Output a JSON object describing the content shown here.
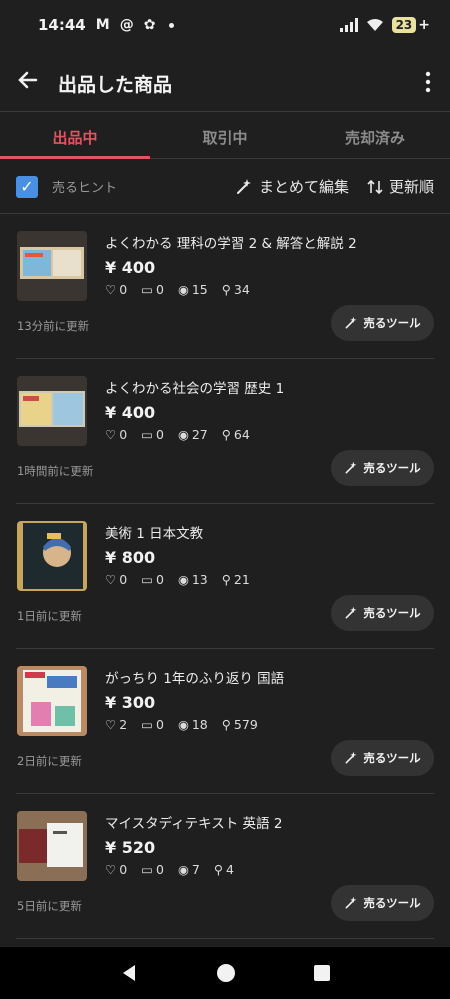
{
  "status_bar": {
    "time": "14:44",
    "battery": "23",
    "notification_icons": [
      "gmail-icon",
      "threads-icon",
      "app-icon"
    ]
  },
  "appbar": {
    "title": "出品した商品"
  },
  "tabs": [
    {
      "label": "出品中",
      "active": true
    },
    {
      "label": "取引中",
      "active": false
    },
    {
      "label": "売却済み",
      "active": false
    }
  ],
  "toolbar": {
    "hint_label": "売るヒント",
    "hint_checked": true,
    "bulk_edit_label": "まとめて編集",
    "sort_label": "更新順"
  },
  "items": [
    {
      "name": "よくわかる 理科の学習 2 & 解答と解説 2",
      "price": "¥ 400",
      "likes": "0",
      "comments": "0",
      "views": "15",
      "searches": "34",
      "updated": "13分前に更新",
      "tool_label": "売るツール"
    },
    {
      "name": "よくわかる社会の学習 歴史 1",
      "price": "¥ 400",
      "likes": "0",
      "comments": "0",
      "views": "27",
      "searches": "64",
      "updated": "1時間前に更新",
      "tool_label": "売るツール"
    },
    {
      "name": "美術 1 日本文教",
      "price": "¥ 800",
      "likes": "0",
      "comments": "0",
      "views": "13",
      "searches": "21",
      "updated": "1日前に更新",
      "tool_label": "売るツール"
    },
    {
      "name": "がっちり 1年のふり返り 国語",
      "price": "¥ 300",
      "likes": "2",
      "comments": "0",
      "views": "18",
      "searches": "579",
      "updated": "2日前に更新",
      "tool_label": "売るツール"
    },
    {
      "name": "マイスタディテキスト 英語 2",
      "price": "¥ 520",
      "likes": "0",
      "comments": "0",
      "views": "7",
      "searches": "4",
      "updated": "5日前に更新",
      "tool_label": "売るツール"
    }
  ],
  "colors": {
    "background": "#1f1f1f",
    "accent": "#e05560",
    "checkbox": "#4a90e2"
  }
}
